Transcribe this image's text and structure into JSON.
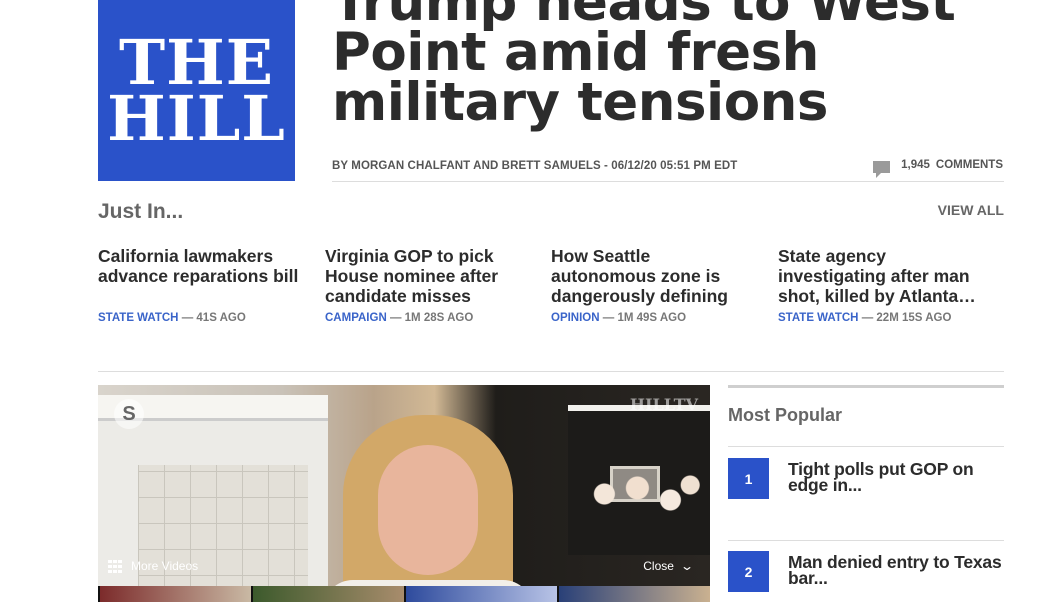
{
  "logo": {
    "line1": "THE",
    "line2": "HILL"
  },
  "article": {
    "headline": "Trump heads to West Point amid fresh military tensions",
    "byline": "BY MORGAN CHALFANT AND BRETT SAMUELS - 06/12/20 05:51 PM EDT",
    "comments_count": "1,945",
    "comments_label": "COMMENTS"
  },
  "just_in": {
    "title": "Just In...",
    "view_all": "VIEW ALL",
    "stories": [
      {
        "title": "California lawmakers advance reparations bill",
        "category": "STATE WATCH",
        "time": "— 41S AGO"
      },
      {
        "title": "Virginia GOP to pick House nominee after candidate misses filing…",
        "category": "CAMPAIGN",
        "time": "— 1M 28S AGO"
      },
      {
        "title": "How Seattle autonomous zone is dangerously defining leadership",
        "category": "OPINION",
        "time": "— 1M 49S AGO"
      },
      {
        "title": "State agency investigating after man shot, killed by Atlanta…",
        "category": "STATE WATCH",
        "time": "— 22M 15S AGO"
      }
    ]
  },
  "video": {
    "watermark": "HILLTV",
    "more_videos": "More Videos",
    "close": "Close",
    "skype_glyph": "S"
  },
  "most_popular": {
    "title": "Most Popular",
    "items": [
      {
        "rank": "1",
        "title": "Tight polls put GOP on edge in..."
      },
      {
        "rank": "2",
        "title": "Man denied entry to Texas bar..."
      }
    ]
  },
  "colors": {
    "brand_blue": "#2a52c9",
    "category_blue": "#3a64c9"
  },
  "icons": [
    "comment-icon",
    "grid-icon",
    "chevron-down-icon",
    "skype-icon"
  ]
}
